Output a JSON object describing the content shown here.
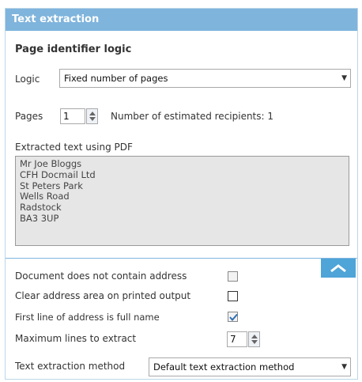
{
  "panel": {
    "title": "Text extraction"
  },
  "page_identifier": {
    "title": "Page identifier logic",
    "logic_label": "Logic",
    "logic_value": "Fixed number of pages"
  },
  "pages": {
    "label": "Pages",
    "value": "1",
    "estimated_recipients": "Number of estimated recipients: 1"
  },
  "extracted": {
    "label": "Extracted text using PDF",
    "lines": [
      "Mr Joe Bloggs",
      "CFH Docmail Ltd",
      "St Peters Park",
      "Wells Road",
      "Radstock",
      "BA3 3UP"
    ]
  },
  "options": {
    "no_address_label": "Document does not contain address",
    "no_address_checked": false,
    "clear_area_label": "Clear address area on printed output",
    "clear_area_checked": false,
    "first_line_label": "First line of address is full name",
    "first_line_checked": true,
    "max_lines_label": "Maximum lines to extract",
    "max_lines_value": "7",
    "method_label": "Text extraction method",
    "method_value": "Default text extraction method"
  },
  "colors": {
    "header": "#7fb4dc",
    "accent": "#4fa4d8",
    "check": "#2f6db5"
  }
}
